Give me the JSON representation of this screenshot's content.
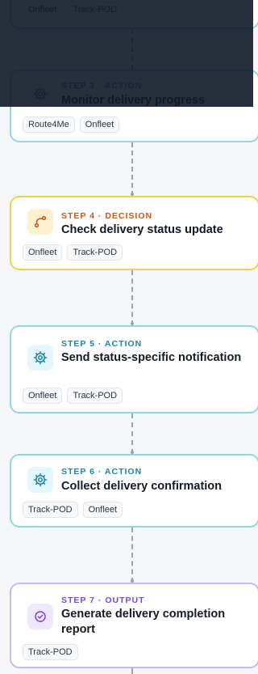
{
  "steps": [
    {
      "label": "",
      "title": "",
      "tags": [
        "Onfleet",
        "Track-POD"
      ]
    },
    {
      "label": "STEP 3 · ACTION",
      "title": "Monitor delivery progress",
      "tags": [
        "Route4Me",
        "Onfleet"
      ],
      "icon": "gear-icon"
    },
    {
      "label": "STEP 4 · DECISION",
      "title": "Check delivery status update",
      "tags": [
        "Onfleet",
        "Track-POD"
      ],
      "icon": "branch-icon"
    },
    {
      "label": "STEP 5 · ACTION",
      "title": "Send status-specific notification",
      "tags": [
        "Onfleet",
        "Track-POD"
      ],
      "icon": "gear-icon"
    },
    {
      "label": "STEP 6 · ACTION",
      "title": "Collect delivery confirmation",
      "tags": [
        "Track-POD",
        "Onfleet"
      ],
      "icon": "gear-icon"
    },
    {
      "label": "STEP 7 · OUTPUT",
      "title": "Generate delivery completion report",
      "tags": [
        "Track-POD"
      ],
      "icon": "check-circle-icon"
    }
  ],
  "colors": {
    "action_border": "#8fd6ea",
    "decision_border": "#f3cf4c",
    "output_border": "#c8b8f2",
    "action_accent": "#1f84a6",
    "decision_accent": "#c15a14",
    "output_accent": "#7c45d8"
  }
}
